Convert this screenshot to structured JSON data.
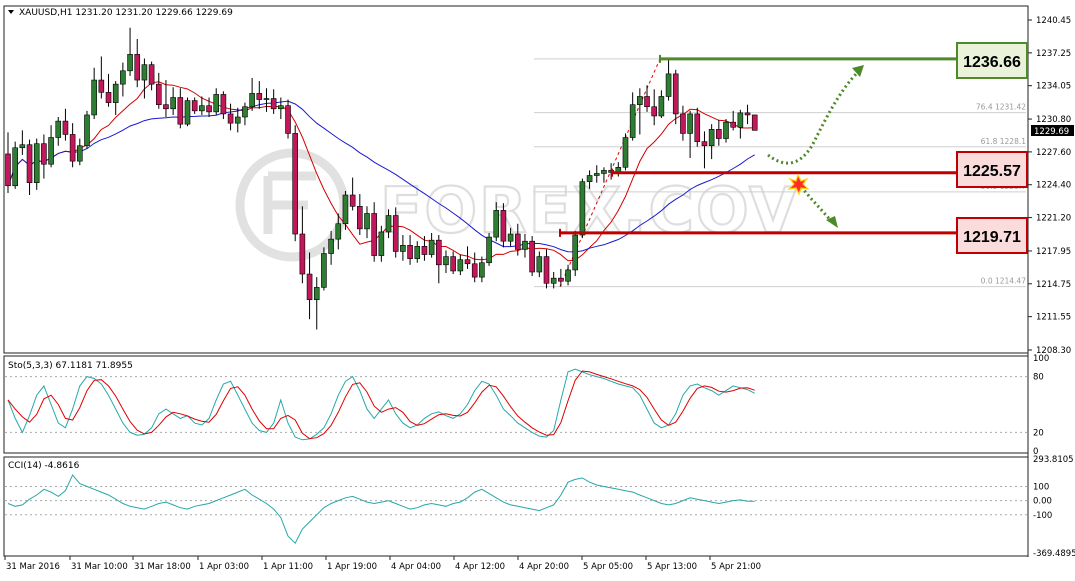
{
  "header": {
    "symbol_line": "XAUUSD,H1  1231.20 1231.20 1229.66 1229.69",
    "current_price": "1229.69"
  },
  "price_axis": {
    "ticks": [
      "1240.45",
      "1237.25",
      "1234.05",
      "1230.80",
      "1227.60",
      "1224.40",
      "1221.20",
      "1217.95",
      "1214.75",
      "1211.55",
      "1208.30"
    ]
  },
  "levels": {
    "resistance": "1236.66",
    "pivot": "1225.57",
    "support": "1219.71"
  },
  "fib": [
    {
      "label": "76.4  1231.42"
    },
    {
      "label": "61.8  1228.1"
    },
    {
      "label": "38.2  1223.7"
    },
    {
      "label": "0.0  1214.47"
    }
  ],
  "watermark": "FOREX.COV",
  "stoch": {
    "label": "Sto(5,3,3) 67.1181 71.8955",
    "ticks": [
      "100",
      "80",
      "20",
      "0"
    ]
  },
  "cci": {
    "label": "CCI(14) -4.8616",
    "ticks": [
      "293.8105",
      "100",
      "0.00",
      "-100",
      "-369.4895"
    ]
  },
  "time_axis": {
    "labels": [
      "31 Mar 2016",
      "31 Mar 10:00",
      "31 Mar 18:00",
      "1 Apr 03:00",
      "1 Apr 11:00",
      "1 Apr 19:00",
      "4 Apr 04:00",
      "4 Apr 12:00",
      "4 Apr 20:00",
      "5 Apr 05:00",
      "5 Apr 13:00",
      "5 Apr 21:00"
    ]
  },
  "colors": {
    "bull": "#2e7d32",
    "bear": "#c2185b",
    "resistance": "#4e8a2a",
    "support": "#c00000",
    "ma_fast": "#d40000",
    "ma_slow": "#1a1ad0",
    "stoch_main": "#26a8a8",
    "stoch_signal": "#e00000",
    "cci": "#26a8a8"
  },
  "chart_data": {
    "type": "candlestick",
    "price_range": [
      1208.3,
      1241.4
    ],
    "candles": [
      [
        1227.4,
        1229.5,
        1223.6,
        1224.3
      ],
      [
        1224.3,
        1228.6,
        1224.0,
        1228.0
      ],
      [
        1228.0,
        1229.7,
        1227.3,
        1228.3
      ],
      [
        1228.3,
        1228.8,
        1223.4,
        1224.6
      ],
      [
        1224.6,
        1228.9,
        1223.9,
        1228.4
      ],
      [
        1228.4,
        1229.3,
        1225.0,
        1226.4
      ],
      [
        1226.4,
        1230.2,
        1226.1,
        1229.0
      ],
      [
        1229.0,
        1231.0,
        1228.2,
        1230.6
      ],
      [
        1230.6,
        1231.8,
        1228.7,
        1229.3
      ],
      [
        1229.3,
        1230.4,
        1226.1,
        1226.7
      ],
      [
        1226.7,
        1228.9,
        1226.3,
        1228.2
      ],
      [
        1228.2,
        1231.6,
        1227.9,
        1231.2
      ],
      [
        1231.2,
        1235.8,
        1230.8,
        1234.6
      ],
      [
        1234.6,
        1236.9,
        1232.8,
        1233.4
      ],
      [
        1233.4,
        1235.2,
        1232.0,
        1232.4
      ],
      [
        1232.4,
        1234.5,
        1231.2,
        1234.2
      ],
      [
        1234.2,
        1236.3,
        1233.0,
        1235.5
      ],
      [
        1235.5,
        1239.7,
        1235.0,
        1237.1
      ],
      [
        1237.1,
        1238.6,
        1233.9,
        1234.6
      ],
      [
        1234.6,
        1236.7,
        1232.8,
        1236.1
      ],
      [
        1236.1,
        1236.4,
        1233.6,
        1234.2
      ],
      [
        1234.2,
        1235.3,
        1231.8,
        1232.2
      ],
      [
        1232.2,
        1234.6,
        1231.0,
        1231.8
      ],
      [
        1231.8,
        1233.9,
        1231.2,
        1232.9
      ],
      [
        1232.9,
        1233.8,
        1229.9,
        1230.3
      ],
      [
        1230.3,
        1232.9,
        1230.1,
        1232.6
      ],
      [
        1232.6,
        1232.9,
        1231.3,
        1231.6
      ],
      [
        1231.6,
        1233.0,
        1231.2,
        1232.1
      ],
      [
        1232.1,
        1232.9,
        1231.0,
        1231.5
      ],
      [
        1231.5,
        1233.8,
        1231.2,
        1233.2
      ],
      [
        1233.2,
        1233.5,
        1230.8,
        1231.3
      ],
      [
        1231.3,
        1232.3,
        1229.7,
        1230.4
      ],
      [
        1230.4,
        1231.9,
        1229.5,
        1231.0
      ],
      [
        1231.0,
        1232.4,
        1230.2,
        1232.0
      ],
      [
        1232.0,
        1234.8,
        1231.6,
        1233.3
      ],
      [
        1233.3,
        1234.5,
        1231.8,
        1232.7
      ],
      [
        1232.7,
        1233.8,
        1231.5,
        1232.8
      ],
      [
        1232.8,
        1233.7,
        1231.3,
        1231.8
      ],
      [
        1231.8,
        1232.9,
        1230.8,
        1232.1
      ],
      [
        1232.1,
        1232.7,
        1228.9,
        1229.4
      ],
      [
        1229.4,
        1230.2,
        1218.9,
        1219.6
      ],
      [
        1219.6,
        1222.3,
        1214.8,
        1215.7
      ],
      [
        1215.7,
        1217.8,
        1211.3,
        1213.2
      ],
      [
        1213.2,
        1215.4,
        1210.3,
        1214.4
      ],
      [
        1214.4,
        1218.3,
        1214.1,
        1217.7
      ],
      [
        1217.7,
        1219.9,
        1216.6,
        1219.1
      ],
      [
        1219.1,
        1221.6,
        1218.1,
        1220.6
      ],
      [
        1220.6,
        1223.8,
        1220.0,
        1223.4
      ],
      [
        1223.4,
        1225.1,
        1221.9,
        1222.3
      ],
      [
        1222.3,
        1223.5,
        1219.5,
        1220.1
      ],
      [
        1220.1,
        1222.3,
        1219.2,
        1221.6
      ],
      [
        1221.6,
        1222.7,
        1216.9,
        1217.5
      ],
      [
        1217.5,
        1220.4,
        1216.9,
        1219.8
      ],
      [
        1219.8,
        1222.0,
        1219.2,
        1221.4
      ],
      [
        1221.4,
        1222.2,
        1217.3,
        1217.9
      ],
      [
        1217.9,
        1219.5,
        1217.0,
        1218.5
      ],
      [
        1218.5,
        1219.5,
        1216.6,
        1217.2
      ],
      [
        1217.2,
        1218.9,
        1216.8,
        1218.4
      ],
      [
        1218.4,
        1219.4,
        1217.0,
        1217.6
      ],
      [
        1217.6,
        1219.7,
        1217.3,
        1219.0
      ],
      [
        1219.0,
        1219.5,
        1214.8,
        1216.6
      ],
      [
        1216.6,
        1218.0,
        1215.8,
        1217.4
      ],
      [
        1217.4,
        1217.9,
        1215.7,
        1216.0
      ],
      [
        1216.0,
        1217.6,
        1215.6,
        1217.1
      ],
      [
        1217.1,
        1218.4,
        1216.2,
        1216.7
      ],
      [
        1216.7,
        1217.8,
        1214.9,
        1215.4
      ],
      [
        1215.4,
        1217.4,
        1214.9,
        1216.8
      ],
      [
        1216.8,
        1219.7,
        1216.5,
        1219.3
      ],
      [
        1219.3,
        1222.7,
        1218.9,
        1221.9
      ],
      [
        1221.9,
        1222.6,
        1218.3,
        1218.9
      ],
      [
        1218.9,
        1220.2,
        1218.4,
        1219.6
      ],
      [
        1219.6,
        1220.6,
        1217.5,
        1218.1
      ],
      [
        1218.1,
        1219.6,
        1217.3,
        1218.9
      ],
      [
        1218.9,
        1219.4,
        1215.5,
        1215.9
      ],
      [
        1215.9,
        1217.9,
        1215.4,
        1217.4
      ],
      [
        1217.4,
        1218.1,
        1214.3,
        1214.8
      ],
      [
        1214.8,
        1215.9,
        1214.3,
        1215.3
      ],
      [
        1215.3,
        1216.2,
        1214.5,
        1215.0
      ],
      [
        1215.0,
        1216.6,
        1214.6,
        1216.1
      ],
      [
        1216.1,
        1219.9,
        1215.5,
        1219.5
      ],
      [
        1219.5,
        1225.0,
        1219.2,
        1224.7
      ],
      [
        1224.7,
        1225.8,
        1224.0,
        1225.3
      ],
      [
        1225.3,
        1226.3,
        1224.6,
        1225.5
      ],
      [
        1225.5,
        1226.1,
        1224.6,
        1225.8
      ],
      [
        1225.8,
        1226.5,
        1224.9,
        1225.6
      ],
      [
        1225.6,
        1226.6,
        1225.2,
        1226.1
      ],
      [
        1226.1,
        1229.4,
        1225.8,
        1229.0
      ],
      [
        1229.0,
        1233.4,
        1228.7,
        1232.2
      ],
      [
        1232.2,
        1233.8,
        1229.3,
        1233.0
      ],
      [
        1233.0,
        1234.1,
        1231.5,
        1232.0
      ],
      [
        1232.0,
        1233.7,
        1230.2,
        1231.1
      ],
      [
        1231.1,
        1233.6,
        1230.9,
        1233.0
      ],
      [
        1233.0,
        1236.6,
        1232.6,
        1235.2
      ],
      [
        1235.2,
        1235.6,
        1230.3,
        1231.3
      ],
      [
        1231.3,
        1232.1,
        1228.7,
        1229.4
      ],
      [
        1229.4,
        1231.6,
        1227.0,
        1231.3
      ],
      [
        1231.3,
        1231.9,
        1228.1,
        1228.6
      ],
      [
        1228.6,
        1229.6,
        1226.0,
        1228.2
      ],
      [
        1228.2,
        1230.3,
        1226.9,
        1229.8
      ],
      [
        1229.8,
        1230.7,
        1228.2,
        1228.9
      ],
      [
        1228.9,
        1230.8,
        1228.5,
        1230.5
      ],
      [
        1230.5,
        1231.6,
        1229.7,
        1230.0
      ],
      [
        1230.0,
        1231.7,
        1228.9,
        1231.4
      ],
      [
        1231.4,
        1232.2,
        1230.3,
        1231.2
      ],
      [
        1231.2,
        1231.2,
        1229.7,
        1229.7
      ]
    ]
  }
}
